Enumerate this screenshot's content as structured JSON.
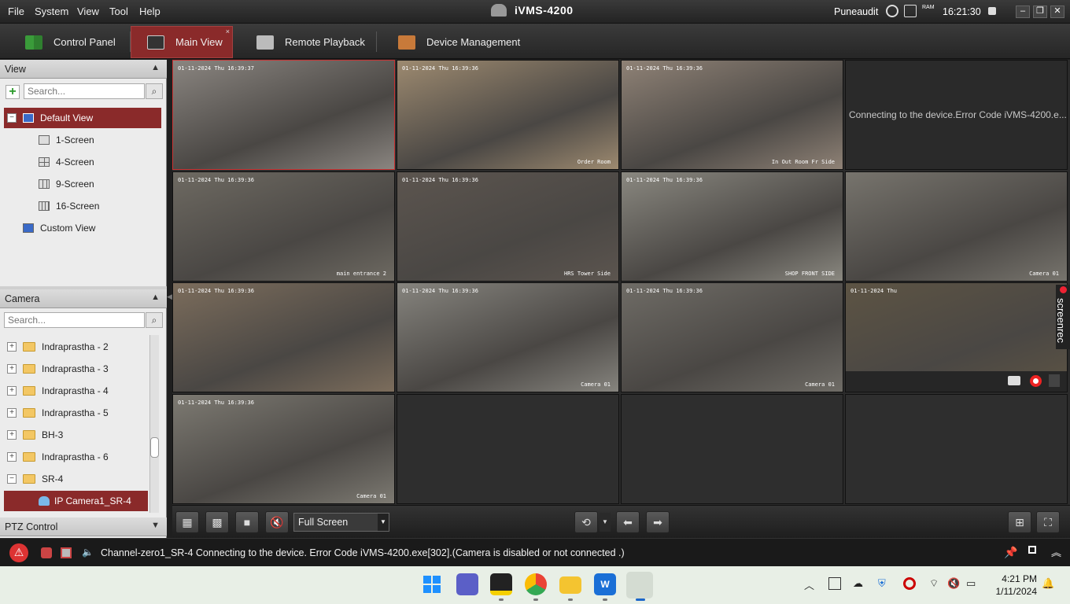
{
  "menu": [
    "File",
    "System",
    "View",
    "Tool",
    "Help"
  ],
  "app_title": "iVMS-4200",
  "user": "Puneaudit",
  "time": "16:21:30",
  "ram_label": "RAM",
  "tabs": [
    {
      "label": "Control Panel"
    },
    {
      "label": "Main View"
    },
    {
      "label": "Remote Playback"
    },
    {
      "label": "Device Management"
    }
  ],
  "view_panel": {
    "title": "View",
    "search_placeholder": "Search...",
    "items": [
      "Default View",
      "1-Screen",
      "4-Screen",
      "9-Screen",
      "16-Screen",
      "Custom View"
    ]
  },
  "camera_panel": {
    "title": "Camera",
    "search_placeholder": "Search...",
    "items": [
      {
        "expander": "+",
        "label": "Indraprastha - 2"
      },
      {
        "expander": "+",
        "label": "Indraprastha - 3"
      },
      {
        "expander": "+",
        "label": "Indraprastha - 4"
      },
      {
        "expander": "+",
        "label": "Indraprastha - 5"
      },
      {
        "expander": "+",
        "label": "BH-3"
      },
      {
        "expander": "+",
        "label": "Indraprastha - 6"
      },
      {
        "expander": "−",
        "label": "SR-4"
      }
    ],
    "selected_camera": "IP Camera1_SR-4"
  },
  "ptz_panel": {
    "title": "PTZ Control"
  },
  "video_cells": [
    {
      "osd": "01-11-2024 Thu 16:39:37",
      "label": "",
      "color": "#8a8580"
    },
    {
      "osd": "01-11-2024 Thu 16:39:36",
      "label": "Order Room",
      "color": "#9d8a70"
    },
    {
      "osd": "01-11-2024 Thu 16:39:36",
      "label": "In Out Room Fr Side",
      "color": "#8f8276"
    },
    {
      "osd": "",
      "label": "",
      "color": "#2a2a2a",
      "error": "Connecting to the device.Error Code iVMS-4200.e..."
    },
    {
      "osd": "01-11-2024 Thu 16:39:36",
      "label": "main entrance 2",
      "color": "#6e6a62"
    },
    {
      "osd": "01-11-2024 Thu 16:39:36",
      "label": "HRS Tower Side",
      "color": "#5c554f"
    },
    {
      "osd": "01-11-2024 Thu 16:39:36",
      "label": "SHOP FRONT SIDE",
      "color": "#8a8880"
    },
    {
      "osd": "",
      "label": "Camera 01",
      "color": "#77746d"
    },
    {
      "osd": "01-11-2024 Thu 16:39:36",
      "label": "",
      "color": "#7c6d5c"
    },
    {
      "osd": "01-11-2024 Thu 16:39:36",
      "label": "Camera 01",
      "color": "#86847e"
    },
    {
      "osd": "01-11-2024 Thu 16:39:36",
      "label": "Camera 01",
      "color": "#6f6c66"
    },
    {
      "osd": "01-11-2024 Thu",
      "label": "",
      "color": "#5d5444"
    },
    {
      "osd": "01-11-2024 Thu 16:39:36",
      "label": "Camera 01",
      "color": "#7d7a72"
    },
    {
      "osd": "",
      "label": "",
      "color": "#2e2e2e"
    },
    {
      "osd": "",
      "label": "",
      "color": "#2e2e2e"
    },
    {
      "osd": "",
      "label": "",
      "color": "#2e2e2e"
    }
  ],
  "toolbar": {
    "display_mode": "Full Screen"
  },
  "status_message": "Channel-zero1_SR-4 Connecting to the device. Error Code iVMS-4200.exe[302].(Camera is disabled or not connected .)",
  "screenrec_label": "screenrec",
  "taskbar": {
    "time": "4:21 PM",
    "date": "1/11/2024"
  }
}
